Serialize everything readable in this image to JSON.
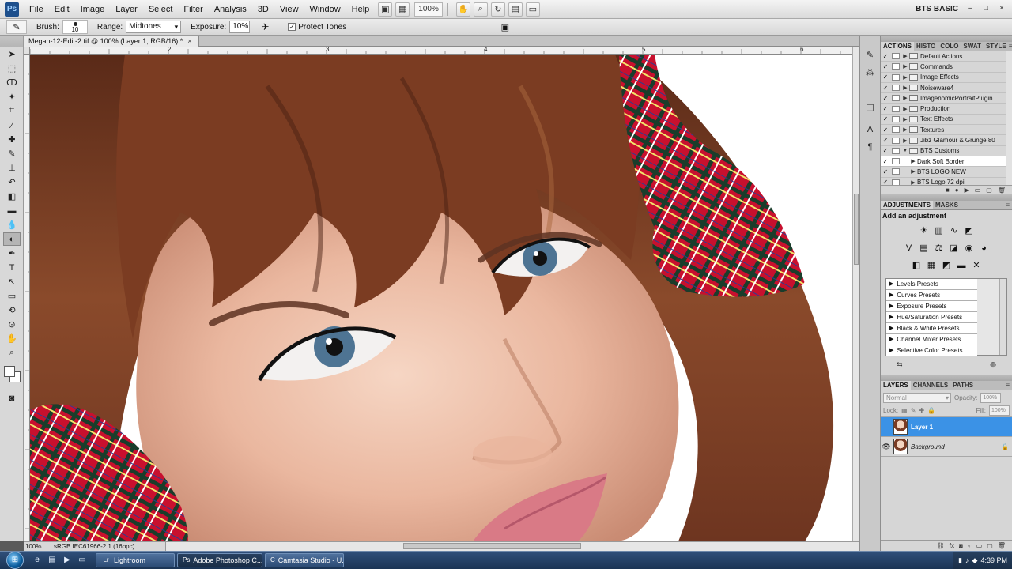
{
  "app": {
    "logo": "Ps",
    "menu": [
      "File",
      "Edit",
      "Image",
      "Layer",
      "Select",
      "Filter",
      "Analysis",
      "3D",
      "View",
      "Window",
      "Help"
    ],
    "zoom": "100%",
    "workspace": "BTS BASIC",
    "window_controls": [
      "–",
      "□",
      "×"
    ]
  },
  "options_bar": {
    "brush_label": "Brush:",
    "brush_size": "10",
    "range_label": "Range:",
    "range_value": "Midtones",
    "exposure_label": "Exposure:",
    "exposure_value": "10%",
    "protect_tones_label": "Protect Tones",
    "protect_tones_checked": true
  },
  "document": {
    "tab_title": "Megan-12-Edit-2.tif @ 100% (Layer 1, RGB/16) *",
    "ruler_top": [
      "2",
      "3",
      "4",
      "5",
      "6"
    ],
    "status_zoom": "100%",
    "status_info": "sRGB IEC61966-2.1 (16bpc)"
  },
  "actions_panel": {
    "tabs": [
      "ACTIONS",
      "HISTO",
      "COLO",
      "SWAT",
      "STYLE"
    ],
    "items": [
      {
        "name": "Default Actions",
        "type": "set",
        "expanded": false
      },
      {
        "name": "Commands",
        "type": "set",
        "expanded": false
      },
      {
        "name": "Image Effects",
        "type": "set",
        "expanded": false
      },
      {
        "name": "Noiseware4",
        "type": "set",
        "expanded": false
      },
      {
        "name": "ImagenomicPortraitPlugin",
        "type": "set",
        "expanded": false
      },
      {
        "name": "Production",
        "type": "set",
        "expanded": false
      },
      {
        "name": "Text Effects",
        "type": "set",
        "expanded": false
      },
      {
        "name": "Textures",
        "type": "set",
        "expanded": false
      },
      {
        "name": "Jibz Glamour & Grunge 80",
        "type": "set",
        "expanded": false
      },
      {
        "name": "BTS Customs",
        "type": "set",
        "expanded": true
      },
      {
        "name": "Dark Soft Border",
        "type": "action",
        "selected": true
      },
      {
        "name": "BTS LOGO NEW",
        "type": "action"
      },
      {
        "name": "BTS Logo 72 dpi",
        "type": "action"
      }
    ]
  },
  "adjustments_panel": {
    "tabs": [
      "ADJUSTMENTS",
      "MASKS"
    ],
    "title": "Add an adjustment",
    "presets": [
      "Levels Presets",
      "Curves Presets",
      "Exposure Presets",
      "Hue/Saturation Presets",
      "Black & White Presets",
      "Channel Mixer Presets",
      "Selective Color Presets"
    ]
  },
  "layers_panel": {
    "tabs": [
      "LAYERS",
      "CHANNELS",
      "PATHS"
    ],
    "blend_mode": "Normal",
    "opacity_label": "Opacity:",
    "opacity_value": "100%",
    "lock_label": "Lock:",
    "fill_label": "Fill:",
    "fill_value": "100%",
    "layers": [
      {
        "name": "Layer 1",
        "selected": true,
        "visible": false
      },
      {
        "name": "Background",
        "selected": false,
        "visible": true,
        "locked": true
      }
    ]
  },
  "taskbar": {
    "start": "⊞",
    "tasks": [
      {
        "label": "Lightroom",
        "active": false
      },
      {
        "label": "Adobe Photoshop C...",
        "active": true
      },
      {
        "label": "Camtasia Studio - U...",
        "active": false
      }
    ],
    "clock": "4:39 PM"
  }
}
